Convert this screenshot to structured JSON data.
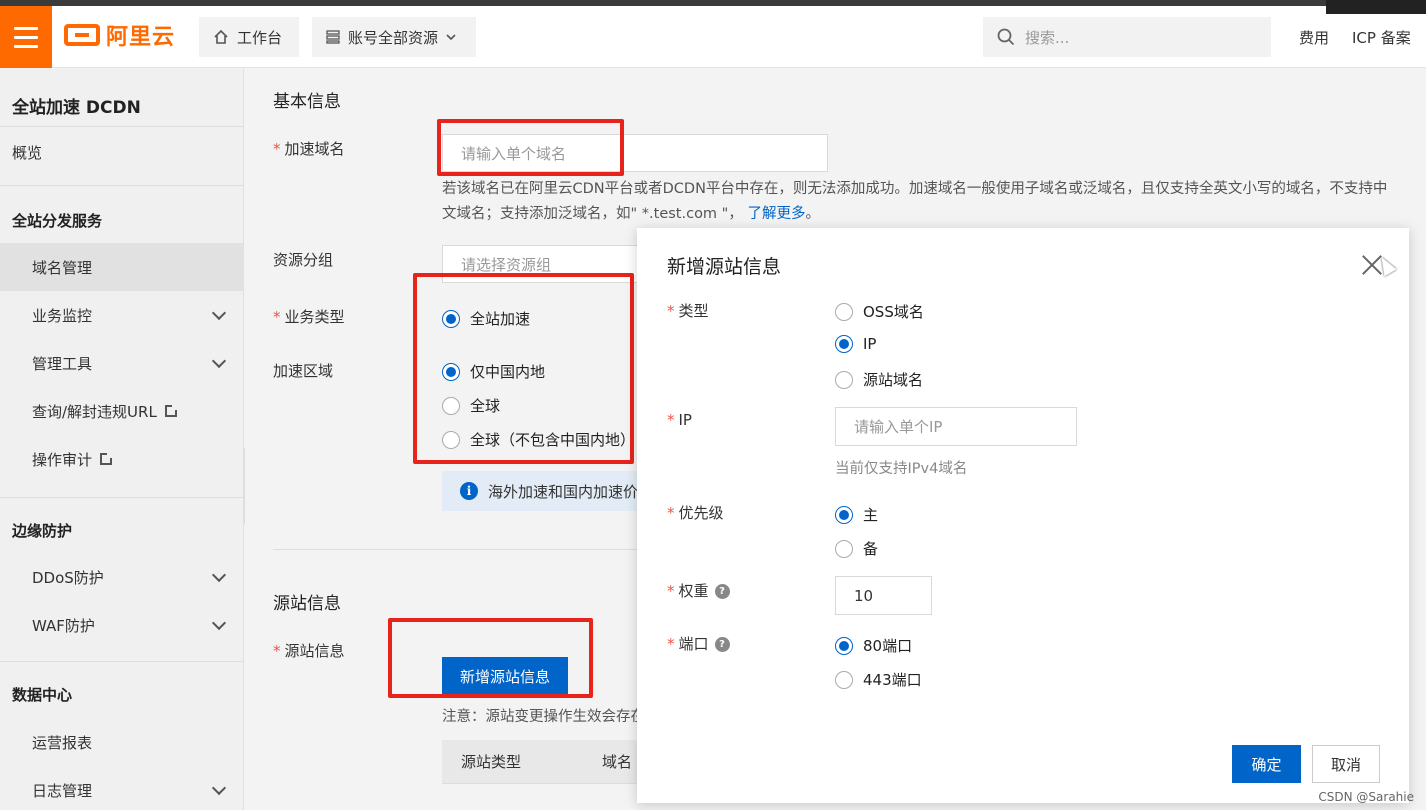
{
  "header": {
    "logo_text": "阿里云",
    "home_label": "工作台",
    "resource_label": "账号全部资源",
    "search_placeholder": "搜索...",
    "links": [
      "费用",
      "ICP 备案"
    ]
  },
  "sidebar": {
    "title": "全站加速 DCDN",
    "overview": "概览",
    "groups": [
      {
        "title": "全站分发服务",
        "items": [
          {
            "label": "域名管理",
            "active": true,
            "expandable": false
          },
          {
            "label": "业务监控",
            "expandable": true
          },
          {
            "label": "管理工具",
            "expandable": true
          },
          {
            "label": "查询/解封违规URL",
            "external": true
          },
          {
            "label": "操作审计",
            "external": true
          }
        ]
      },
      {
        "title": "边缘防护",
        "items": [
          {
            "label": "DDoS防护",
            "expandable": true
          },
          {
            "label": "WAF防护",
            "expandable": true
          }
        ]
      },
      {
        "title": "数据中心",
        "items": [
          {
            "label": "运营报表",
            "expandable": false
          },
          {
            "label": "日志管理",
            "expandable": true
          }
        ]
      }
    ]
  },
  "form": {
    "basic_title": "基本信息",
    "domain_label": "加速域名",
    "domain_placeholder": "请输入单个域名",
    "domain_hint_1": "若该域名已在阿里云CDN平台或者DCDN平台中存在，则无法添加成功。加速域名一般使用子域名或泛域名，且仅支持全英文小写的域名，不支持中",
    "domain_hint_2": "文域名；支持添加泛域名，如\" *.test.com \"，",
    "learn_more": "了解更多",
    "resource_group_label": "资源分组",
    "resource_group_placeholder": "请选择资源组",
    "business_type_label": "业务类型",
    "business_type_option": "全站加速",
    "region_label": "加速区域",
    "region_options": [
      "仅中国内地",
      "全球",
      "全球（不包含中国内地）"
    ],
    "region_selected": 0,
    "notice_text": "海外加速和国内加速价",
    "origin_title": "源站信息",
    "origin_label": "源站信息",
    "add_origin_button": "新增源站信息",
    "origin_note": "注意：源站变更操作生效会存在",
    "table_headers": [
      "源站类型",
      "域名"
    ]
  },
  "modal": {
    "title": "新增源站信息",
    "type_label": "类型",
    "type_options": [
      "OSS域名",
      "IP",
      "源站域名"
    ],
    "type_selected": 1,
    "ip_label": "IP",
    "ip_placeholder": "请输入单个IP",
    "ip_hint": "当前仅支持IPv4域名",
    "priority_label": "优先级",
    "priority_options": [
      "主",
      "备"
    ],
    "priority_selected": 0,
    "weight_label": "权重",
    "weight_value": "10",
    "port_label": "端口",
    "port_options": [
      "80端口",
      "443端口"
    ],
    "port_selected": 0,
    "confirm_button": "确定",
    "cancel_button": "取消"
  },
  "watermark": "CSDN @Sarahie",
  "colors": {
    "brand": "#ff6a00",
    "primary": "#0064c8",
    "annotation": "#e8231b"
  }
}
